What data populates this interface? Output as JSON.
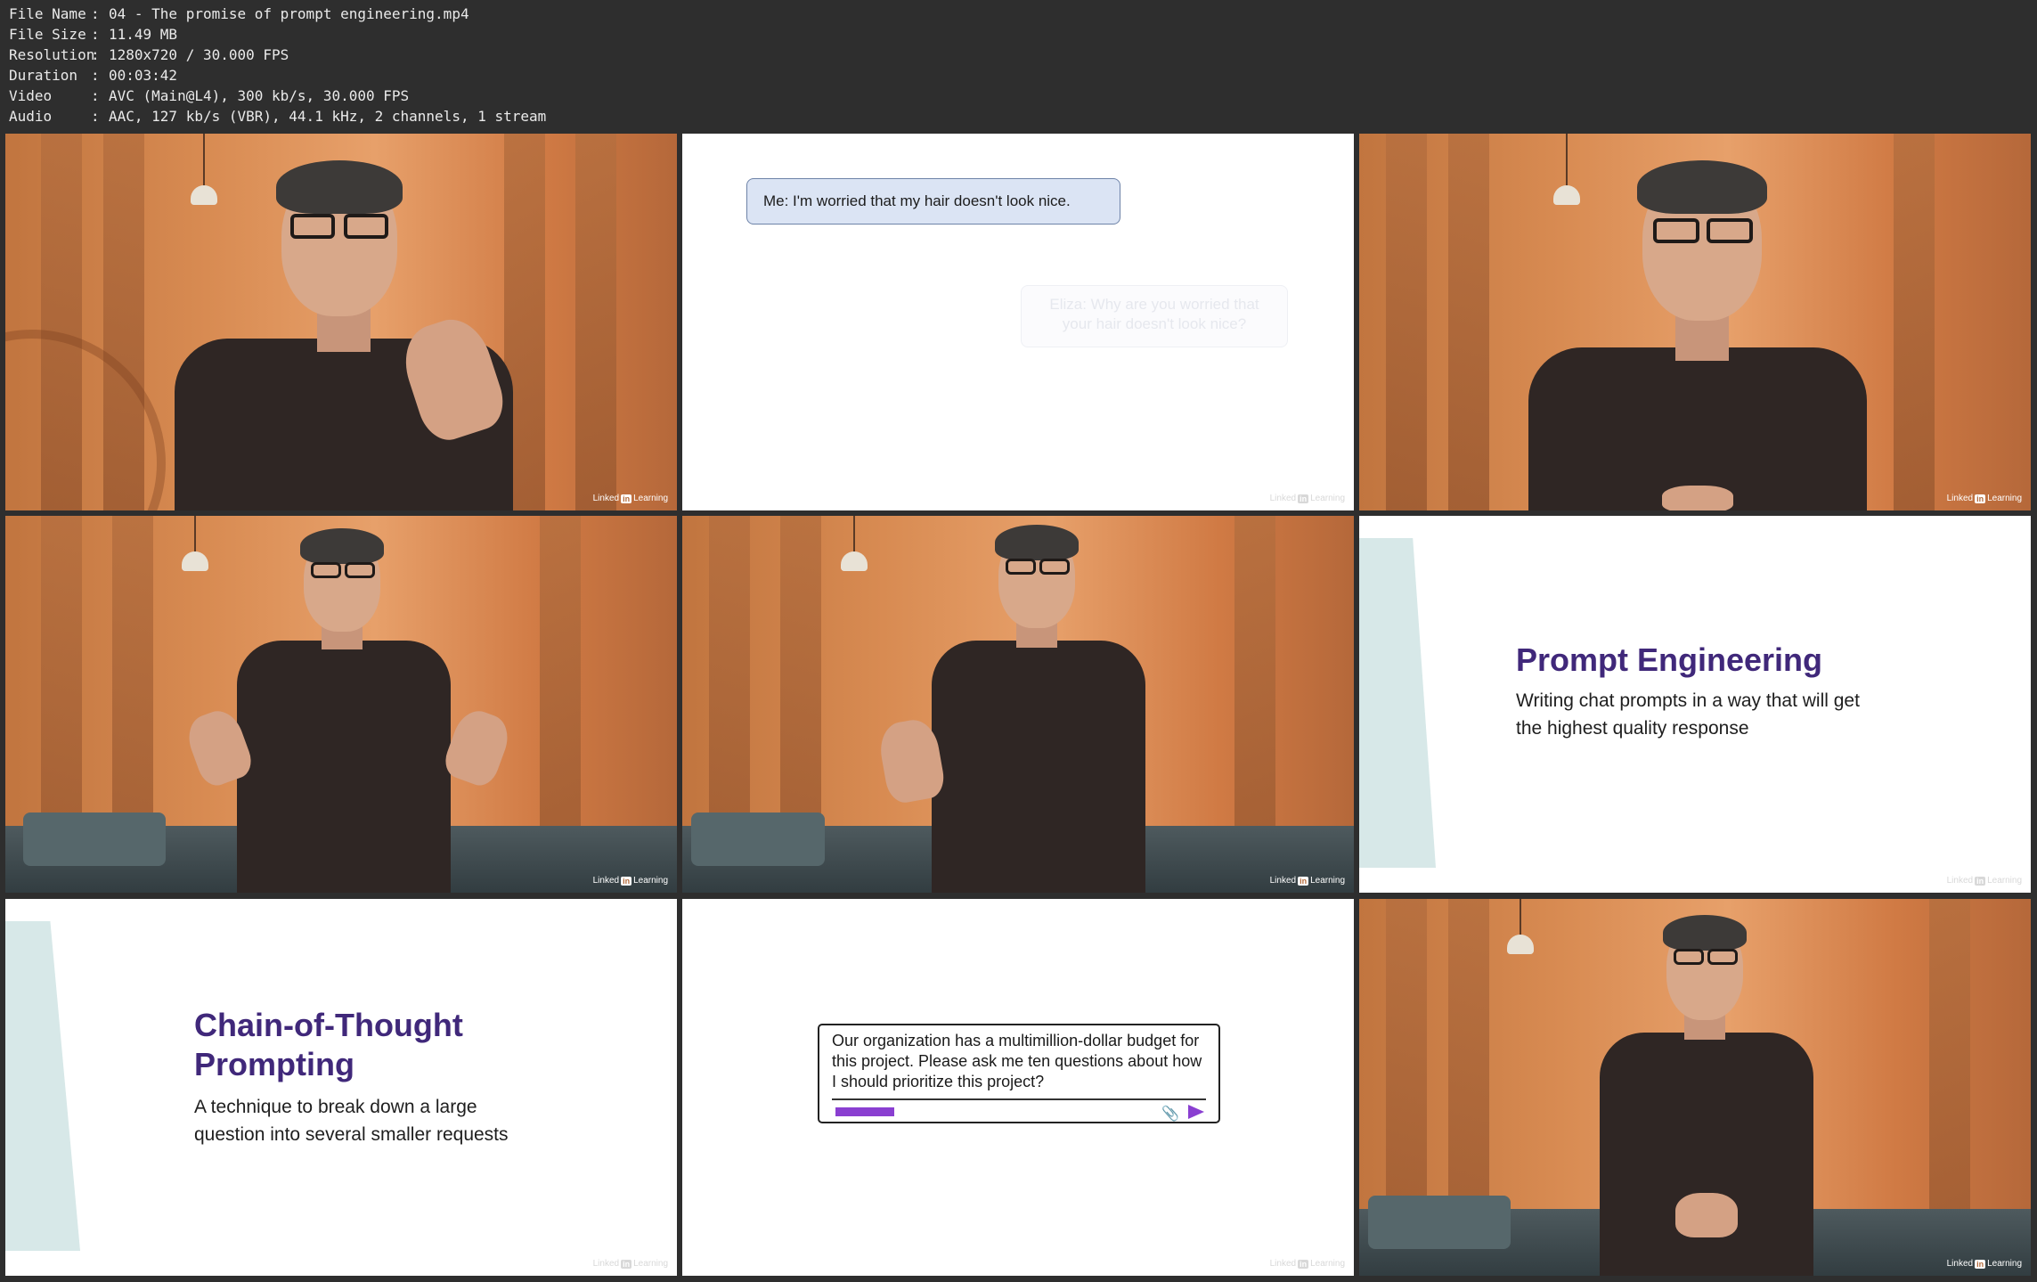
{
  "info": {
    "rows": [
      {
        "key": "File Name",
        "value": "04 - The promise of prompt engineering.mp4"
      },
      {
        "key": "File Size",
        "value": "11.49 MB"
      },
      {
        "key": "Resolution",
        "value": "1280x720 / 30.000 FPS"
      },
      {
        "key": "Duration",
        "value": "00:03:42"
      },
      {
        "key": "Video",
        "value": "AVC (Main@L4), 300 kb/s, 30.000 FPS"
      },
      {
        "key": "Audio",
        "value": "AAC, 127 kb/s (VBR), 44.1 kHz, 2 channels, 1 stream"
      }
    ],
    "separator": ":"
  },
  "watermark": {
    "brand": "Linked",
    "in": "in",
    "product": "Learning"
  },
  "slides": {
    "chat": {
      "me": "Me: I'm worried that my hair doesn't look nice.",
      "eliza": "Eliza: Why are you worried that your hair doesn't look nice?"
    },
    "prompt_engineering": {
      "title": "Prompt Engineering",
      "subtitle": "Writing chat prompts in a way that will get the highest quality response"
    },
    "chain_of_thought": {
      "title": "Chain-of-Thought Prompting",
      "subtitle": "A technique to break down a large question into several smaller requests"
    },
    "prompt_box": {
      "text": "Our organization has a multimillion-dollar budget for this project. Please ask me ten questions about how I should prioritize this project?"
    }
  },
  "colors": {
    "background": "#2e2e2e",
    "slide_title": "#40287a",
    "accent": "#8a3fd1",
    "shape": "#d7e8e8"
  }
}
